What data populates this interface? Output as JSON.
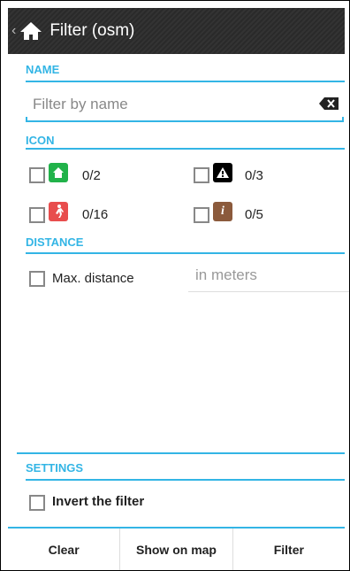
{
  "actionbar": {
    "back_glyph": "‹",
    "title": "Filter (osm)"
  },
  "sections": {
    "name": "NAME",
    "icon": "ICON",
    "distance": "DISTANCE",
    "settings": "SETTINGS"
  },
  "search": {
    "placeholder": "Filter by name"
  },
  "icons": [
    {
      "name": "green-home-icon",
      "count": "0/2",
      "color": "#21b24a"
    },
    {
      "name": "warning-icon",
      "count": "0/3",
      "color": "#000000"
    },
    {
      "name": "person-walking-icon",
      "count": "0/16",
      "color": "#e84d4d"
    },
    {
      "name": "info-icon",
      "count": "0/5",
      "color": "#8b5a3c"
    }
  ],
  "distance": {
    "label": "Max. distance",
    "placeholder": "in meters"
  },
  "settings": {
    "invert_label": "Invert the filter"
  },
  "buttons": {
    "clear": "Clear",
    "show_on_map": "Show on map",
    "filter": "Filter"
  },
  "colors": {
    "accent": "#33b5e5",
    "actionbar": "#2f2f2f"
  }
}
